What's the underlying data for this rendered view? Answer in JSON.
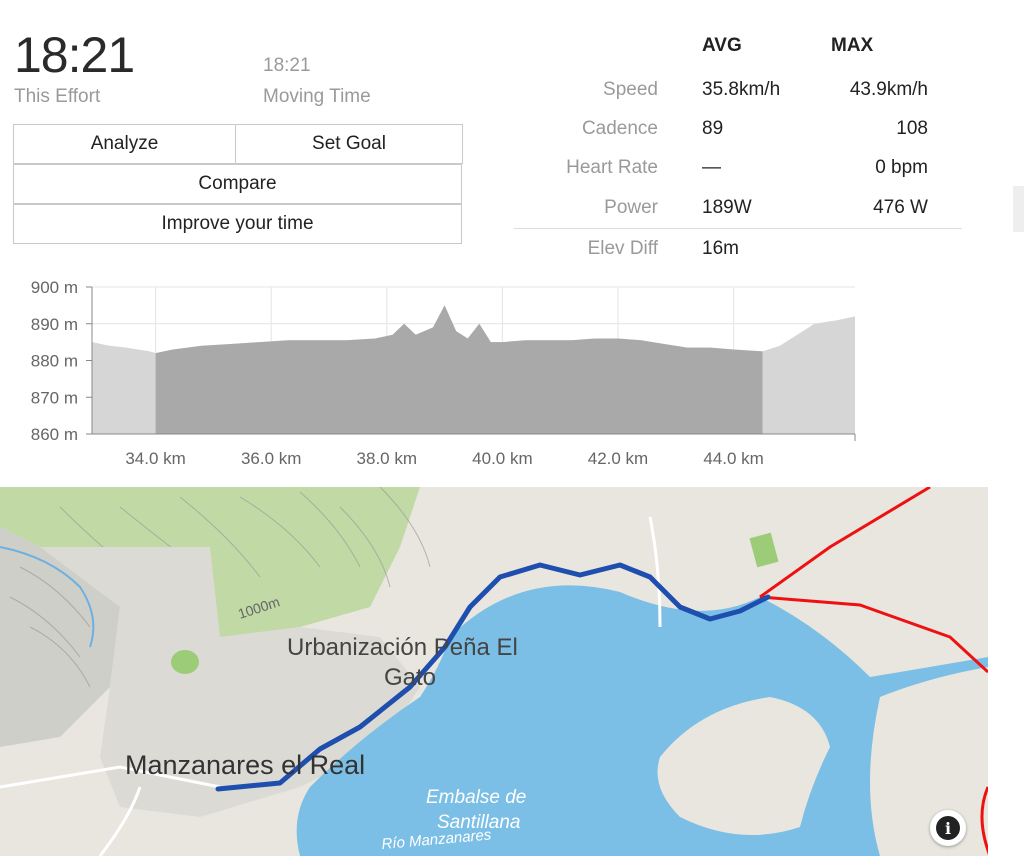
{
  "effort": {
    "time": "18:21",
    "time_label": "This Effort",
    "moving_time": "18:21",
    "moving_time_label": "Moving Time"
  },
  "actions": {
    "analyze": "Analyze",
    "set_goal": "Set Goal",
    "compare": "Compare",
    "improve": "Improve your time"
  },
  "stats": {
    "headers": {
      "avg": "AVG",
      "max": "MAX"
    },
    "rows": [
      {
        "label": "Speed",
        "avg": "35.8km/h",
        "max": "43.9km/h"
      },
      {
        "label": "Cadence",
        "avg": "89",
        "max": "108"
      },
      {
        "label": "Heart Rate",
        "avg": "—",
        "max": "0 bpm"
      },
      {
        "label": "Power",
        "avg": "189W",
        "max": "476 W"
      }
    ],
    "elev_diff": {
      "label": "Elev Diff",
      "value": "16m"
    }
  },
  "chart_data": {
    "type": "area",
    "x_unit": "km",
    "y_unit": "m",
    "y_ticks": [
      "900 m",
      "890 m",
      "880 m",
      "870 m",
      "860 m"
    ],
    "x_ticks": [
      "34.0 km",
      "36.0 km",
      "38.0 km",
      "40.0 km",
      "42.0 km",
      "44.0 km"
    ],
    "ylim": [
      860,
      900
    ],
    "xlim": [
      32.9,
      46.1
    ],
    "segment_range_km": [
      34.0,
      44.5
    ],
    "x": [
      32.9,
      33.2,
      33.5,
      33.9,
      34.0,
      34.3,
      34.8,
      35.3,
      35.8,
      36.3,
      36.8,
      37.3,
      37.8,
      38.1,
      38.3,
      38.5,
      38.8,
      39.0,
      39.2,
      39.4,
      39.6,
      39.8,
      40.0,
      40.4,
      40.8,
      41.2,
      41.6,
      42.0,
      42.4,
      42.8,
      43.2,
      43.6,
      44.0,
      44.5,
      44.8,
      45.1,
      45.4,
      45.8,
      46.1
    ],
    "y": [
      885,
      884,
      883.5,
      882.5,
      882,
      883,
      884,
      884.5,
      885,
      885.5,
      885.5,
      885.5,
      886,
      887,
      890,
      887,
      889,
      895,
      888,
      886,
      890,
      885,
      885,
      885.5,
      885.5,
      885.5,
      886,
      886,
      885.5,
      884.5,
      883.5,
      883.5,
      883,
      882.5,
      884,
      887,
      890,
      891,
      892
    ],
    "grid": true
  },
  "map": {
    "labels": {
      "urbanizacion": "Urbanización Peña El",
      "gato": "Gato",
      "manzanares": "Manzanares el Real",
      "embalse_1": "Embalse de",
      "embalse_2": "Santillana",
      "rio": "Río Manzanares",
      "contour": "1000m"
    },
    "colors": {
      "route": "#1f4fae",
      "other_route": "#ee1111",
      "water": "#7cbfe6",
      "land": "#e9e7e1",
      "forest": "#a8cf87"
    },
    "info_icon": "info-icon"
  }
}
